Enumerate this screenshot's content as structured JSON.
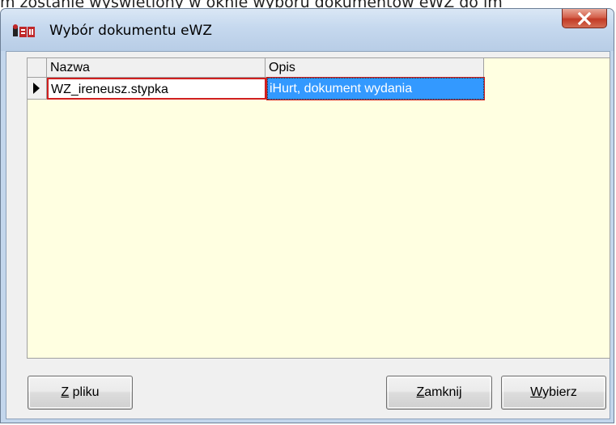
{
  "background_text": "m zostanie wyświetlony w oknie wyboru dokumentów eWZ do im",
  "window": {
    "title": "Wybór dokumentu eWZ",
    "icon": "app-logo-icon",
    "close_glyph": "x"
  },
  "grid": {
    "columns": [
      "Nazwa",
      "Opis"
    ],
    "rows": [
      {
        "name": "WZ_ireneusz.stypka",
        "description": "iHurt, dokument wydania"
      }
    ],
    "selected_row_indicator": "row-pointer-icon"
  },
  "buttons": {
    "from_file": {
      "mnemonic": "Z",
      "rest": " pliku"
    },
    "close": {
      "mnemonic": "Z",
      "rest": "amknij"
    },
    "select": {
      "mnemonic": "W",
      "rest": "ybierz"
    }
  },
  "colors": {
    "grid_background": "#ffffe1",
    "selection": "#3399ff",
    "focus_border": "#d02020"
  }
}
